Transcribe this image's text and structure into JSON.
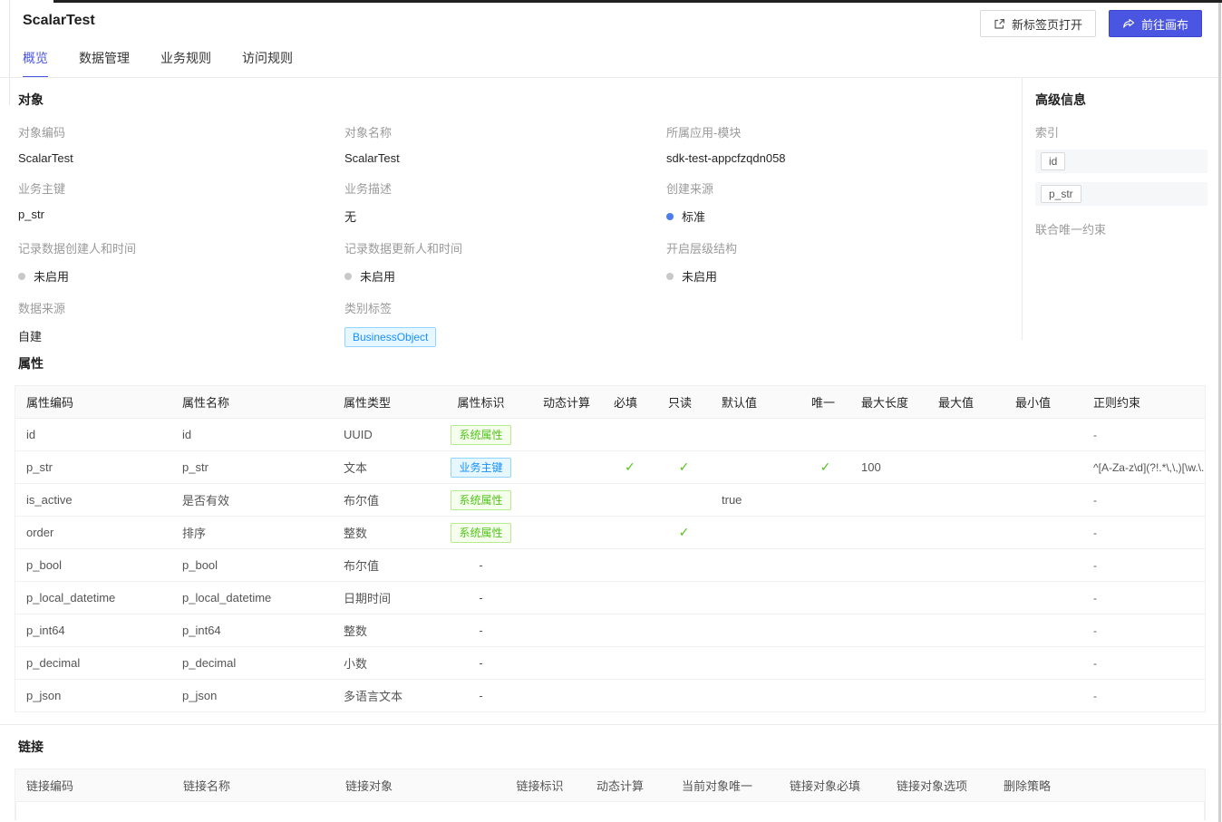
{
  "header": {
    "title": "ScalarTest",
    "open_new_tab_button": "新标签页打开",
    "go_canvas_button": "前往画布"
  },
  "tabs": [
    {
      "label": "概览",
      "active": true
    },
    {
      "label": "数据管理",
      "active": false
    },
    {
      "label": "业务规则",
      "active": false
    },
    {
      "label": "访问规则",
      "active": false
    }
  ],
  "object_section": {
    "title": "对象",
    "fields": [
      {
        "label": "对象编码",
        "value": "ScalarTest",
        "kind": "text"
      },
      {
        "label": "对象名称",
        "value": "ScalarTest",
        "kind": "text"
      },
      {
        "label": "所属应用-模块",
        "value": "sdk-test-appcfzqdn058",
        "kind": "text"
      },
      {
        "label": "业务主键",
        "value": "p_str",
        "kind": "text"
      },
      {
        "label": "业务描述",
        "value": "无",
        "kind": "text"
      },
      {
        "label": "创建来源",
        "value": "标准",
        "kind": "dot-blue"
      },
      {
        "label": "记录数据创建人和时间",
        "value": "未启用",
        "kind": "dot-gray"
      },
      {
        "label": "记录数据更新人和时间",
        "value": "未启用",
        "kind": "dot-gray"
      },
      {
        "label": "开启层级结构",
        "value": "未启用",
        "kind": "dot-gray"
      },
      {
        "label": "数据来源",
        "value": "自建",
        "kind": "text"
      },
      {
        "label": "类别标签",
        "value": "BusinessObject",
        "kind": "tag-blue"
      }
    ]
  },
  "advanced_panel": {
    "title": "高级信息",
    "index_label": "索引",
    "index_items": [
      "id",
      "p_str"
    ],
    "unique_constraint_label": "联合唯一约束"
  },
  "attributes_section": {
    "title": "属性",
    "columns": [
      "属性编码",
      "属性名称",
      "属性类型",
      "属性标识",
      "动态计算",
      "必填",
      "只读",
      "默认值",
      "唯一",
      "最大长度",
      "最大值",
      "最小值",
      "正则约束"
    ],
    "rows": [
      {
        "code": "id",
        "name": "id",
        "type": "UUID",
        "flag": {
          "text": "系统属性",
          "style": "green"
        },
        "dynamic": "",
        "required": false,
        "readonly": false,
        "default": "",
        "unique": false,
        "max_length": "",
        "max_value": "",
        "min_value": "",
        "regex": "-"
      },
      {
        "code": "p_str",
        "name": "p_str",
        "type": "文本",
        "flag": {
          "text": "业务主键",
          "style": "blue"
        },
        "dynamic": "",
        "required": true,
        "readonly": true,
        "default": "",
        "unique": true,
        "max_length": "100",
        "max_value": "",
        "min_value": "",
        "regex": "^[A-Za-z\\d](?!.*\\,\\,)[\\w.\\..."
      },
      {
        "code": "is_active",
        "name": "是否有效",
        "type": "布尔值",
        "flag": {
          "text": "系统属性",
          "style": "green"
        },
        "dynamic": "",
        "required": false,
        "readonly": false,
        "default": "true",
        "unique": false,
        "max_length": "",
        "max_value": "",
        "min_value": "",
        "regex": "-"
      },
      {
        "code": "order",
        "name": "排序",
        "type": "整数",
        "flag": {
          "text": "系统属性",
          "style": "green"
        },
        "dynamic": "",
        "required": false,
        "readonly": true,
        "default": "",
        "unique": false,
        "max_length": "",
        "max_value": "",
        "min_value": "",
        "regex": "-"
      },
      {
        "code": "p_bool",
        "name": "p_bool",
        "type": "布尔值",
        "flag": {
          "text": "-",
          "style": "dash"
        },
        "dynamic": "",
        "required": false,
        "readonly": false,
        "default": "",
        "unique": false,
        "max_length": "",
        "max_value": "",
        "min_value": "",
        "regex": "-"
      },
      {
        "code": "p_local_datetime",
        "name": "p_local_datetime",
        "type": "日期时间",
        "flag": {
          "text": "-",
          "style": "dash"
        },
        "dynamic": "",
        "required": false,
        "readonly": false,
        "default": "",
        "unique": false,
        "max_length": "",
        "max_value": "",
        "min_value": "",
        "regex": "-"
      },
      {
        "code": "p_int64",
        "name": "p_int64",
        "type": "整数",
        "flag": {
          "text": "-",
          "style": "dash"
        },
        "dynamic": "",
        "required": false,
        "readonly": false,
        "default": "",
        "unique": false,
        "max_length": "",
        "max_value": "",
        "min_value": "",
        "regex": "-"
      },
      {
        "code": "p_decimal",
        "name": "p_decimal",
        "type": "小数",
        "flag": {
          "text": "-",
          "style": "dash"
        },
        "dynamic": "",
        "required": false,
        "readonly": false,
        "default": "",
        "unique": false,
        "max_length": "",
        "max_value": "",
        "min_value": "",
        "regex": "-"
      },
      {
        "code": "p_json",
        "name": "p_json",
        "type": "多语言文本",
        "flag": {
          "text": "-",
          "style": "dash"
        },
        "dynamic": "",
        "required": false,
        "readonly": false,
        "default": "",
        "unique": false,
        "max_length": "",
        "max_value": "",
        "min_value": "",
        "regex": "-"
      }
    ]
  },
  "links_section": {
    "title": "链接",
    "columns": [
      "链接编码",
      "链接名称",
      "链接对象",
      "链接标识",
      "动态计算",
      "当前对象唯一",
      "链接对象必填",
      "链接对象选项",
      "删除策略"
    ]
  },
  "colors": {
    "accent": "#4a55e2",
    "dot_blue": "#4a7deb",
    "dot_gray": "#c8c8c8",
    "check_green": "#52c41a",
    "tag_blue_text": "#1890ff",
    "tag_green_text": "#52c41a"
  }
}
